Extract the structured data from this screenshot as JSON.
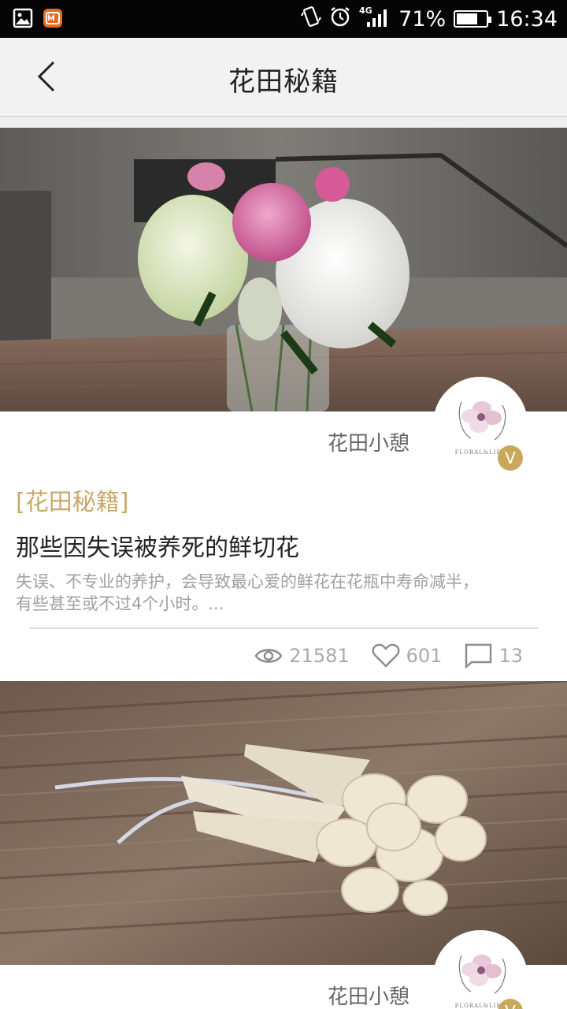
{
  "status_bar": {
    "network": "4G",
    "battery_percent": "71%",
    "battery_level": 0.71,
    "time": "16:34",
    "icons": [
      "gallery-icon",
      "app-notification-icon",
      "vibrate-icon",
      "alarm-icon",
      "signal-icon",
      "battery-icon"
    ]
  },
  "header": {
    "title": "花田秘籍",
    "back_icon": "chevron-left-icon"
  },
  "articles": [
    {
      "author": "花田小憩",
      "avatar_badge": "V",
      "tag": "[花田秘籍]",
      "title": "那些因失误被养死的鲜切花",
      "excerpt": "失误、不专业的养护，会导致最心爱的鲜花在花瓶中寿命减半，有些甚至或不过4个小时。...",
      "views": "21581",
      "likes": "601",
      "comments": "13"
    },
    {
      "author": "花田小憩",
      "avatar_badge": "V"
    }
  ],
  "colors": {
    "accent": "#c8a96a",
    "badge": "#c9a85a",
    "header_bg": "#f2f2f2"
  }
}
